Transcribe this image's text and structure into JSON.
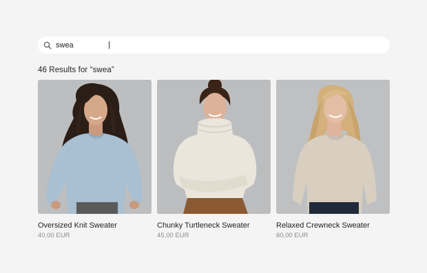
{
  "search": {
    "value": "swea",
    "icon": "search-icon"
  },
  "results": {
    "heading": "46 Results for “swea”"
  },
  "products": [
    {
      "name": "Oversized Knit Sweater",
      "price": "40,00 EUR"
    },
    {
      "name": "Chunky Turtleneck Sweater",
      "price": "45,00 EUR"
    },
    {
      "name": "Relaxed Crewneck Sweater",
      "price": "60,00 EUR"
    }
  ],
  "colors": {
    "background": "#f4f4f4",
    "card_background": "#ffffff",
    "photo_background": "#bcbdbf",
    "sweater_1": "#a9bfd2",
    "sweater_2": "#ebe6dc",
    "sweater_3": "#d8cfc1"
  }
}
